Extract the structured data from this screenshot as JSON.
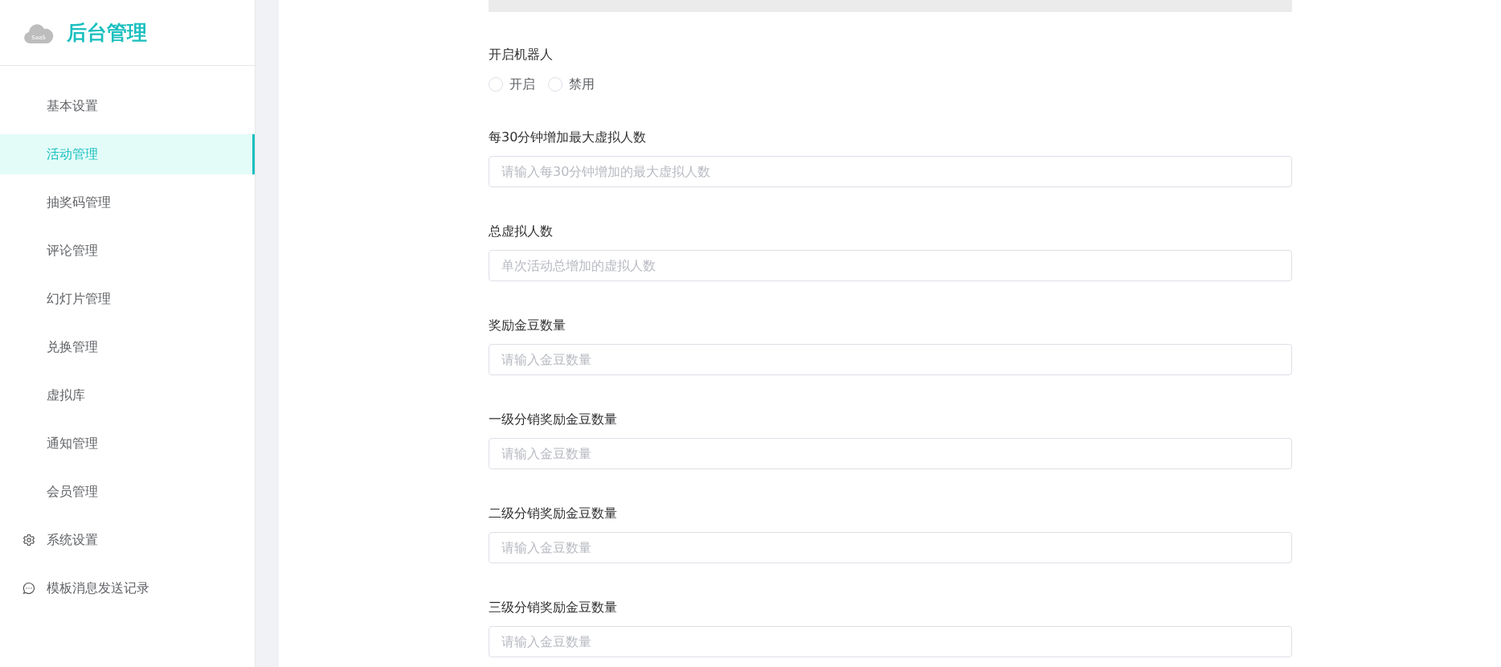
{
  "brand": {
    "logo_text": "SaaS",
    "title": "后台管理"
  },
  "sidebar": {
    "items": [
      {
        "label": "基本设置",
        "kind": "item",
        "selected": false
      },
      {
        "label": "活动管理",
        "kind": "item",
        "selected": true
      },
      {
        "label": "抽奖码管理",
        "kind": "item",
        "selected": false
      },
      {
        "label": "评论管理",
        "kind": "item",
        "selected": false
      },
      {
        "label": "幻灯片管理",
        "kind": "item",
        "selected": false
      },
      {
        "label": "兑换管理",
        "kind": "item",
        "selected": false
      },
      {
        "label": "虚拟库",
        "kind": "item",
        "selected": false
      },
      {
        "label": "通知管理",
        "kind": "item",
        "selected": false
      },
      {
        "label": "会员管理",
        "kind": "item",
        "selected": false
      },
      {
        "label": "系统设置",
        "kind": "settings",
        "selected": false
      },
      {
        "label": "模板消息发送记录",
        "kind": "messages",
        "selected": false
      }
    ]
  },
  "form": {
    "fields": [
      {
        "kind": "radio",
        "label": "开启机器人",
        "options": [
          {
            "label": "开启",
            "selected": false
          },
          {
            "label": "禁用",
            "selected": false
          }
        ]
      },
      {
        "kind": "input",
        "label": "每30分钟增加最大虚拟人数",
        "placeholder": "请输入每30分钟增加的最大虚拟人数"
      },
      {
        "kind": "input",
        "label": "总虚拟人数",
        "placeholder": "单次活动总增加的虚拟人数"
      },
      {
        "kind": "input",
        "label": "奖励金豆数量",
        "placeholder": "请输入金豆数量"
      },
      {
        "kind": "input",
        "label": "一级分销奖励金豆数量",
        "placeholder": "请输入金豆数量"
      },
      {
        "kind": "input",
        "label": "二级分销奖励金豆数量",
        "placeholder": "请输入金豆数量"
      },
      {
        "kind": "input",
        "label": "三级分销奖励金豆数量",
        "placeholder": "请输入金豆数量"
      }
    ]
  }
}
